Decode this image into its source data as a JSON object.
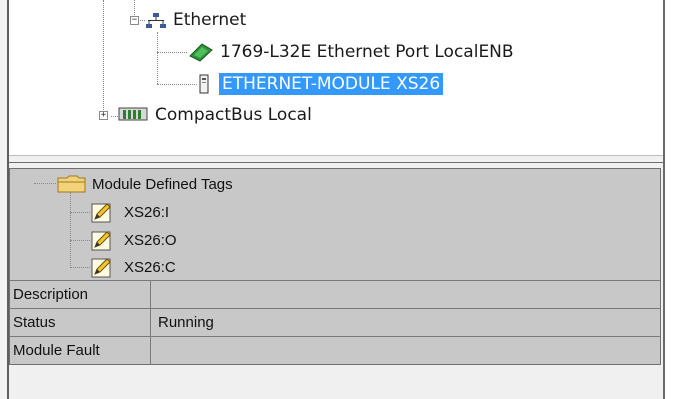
{
  "tree": {
    "ethernet": {
      "label": "Ethernet",
      "expander": "−",
      "icon": "network-icon"
    },
    "port": {
      "label": "1769-L32E Ethernet Port LocalENB",
      "icon": "ethernet-port-icon"
    },
    "module": {
      "label": "ETHERNET-MODULE XS26",
      "icon": "module-icon",
      "selected": true
    },
    "compactbus": {
      "label": "CompactBus Local",
      "expander": "+",
      "icon": "backplane-icon"
    }
  },
  "properties": {
    "folder": {
      "label": "Module Defined Tags",
      "icon": "folder-icon"
    },
    "tags": [
      {
        "label": "XS26:I",
        "icon": "pencil-icon"
      },
      {
        "label": "XS26:O",
        "icon": "pencil-icon"
      },
      {
        "label": "XS26:C",
        "icon": "pencil-icon"
      }
    ],
    "rows": [
      {
        "name": "Description",
        "value": ""
      },
      {
        "name": "Status",
        "value": "Running"
      },
      {
        "name": "Module Fault",
        "value": ""
      }
    ]
  },
  "colors": {
    "selection": "#3399ff",
    "grid_background": "#c8c8c8",
    "pane_background": "#f0f0f0"
  }
}
